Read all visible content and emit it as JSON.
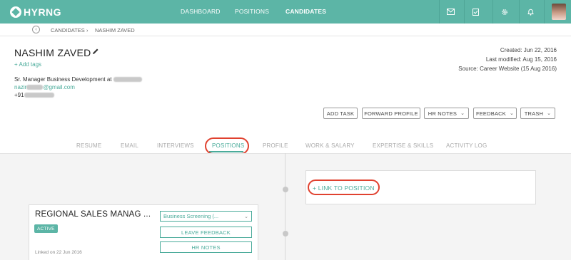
{
  "app": {
    "logo_text": "HYRNG"
  },
  "nav": {
    "items": [
      {
        "label": "DASHBOARD"
      },
      {
        "label": "POSITIONS"
      },
      {
        "label": "CANDIDATES"
      }
    ],
    "active": "CANDIDATES",
    "icons": [
      "mail-icon",
      "checklist-icon",
      "settings-icon",
      "bell-icon"
    ]
  },
  "breadcrumb": {
    "items": [
      "CANDIDATES",
      "›",
      "NASHIM ZAVED"
    ]
  },
  "candidate": {
    "name": "NASHIM ZAVED",
    "add_tags": "+ Add tags",
    "title": "Sr. Manager Business Development at",
    "email_prefix": "nazir",
    "email_suffix": "@gmail.com",
    "phone_prefix": "+91"
  },
  "meta": {
    "created": "Created: Jun 22, 2016",
    "modified": "Last modified: Aug 15, 2016",
    "source": "Source: Career Website (15 Aug 2016)"
  },
  "actions": {
    "add_task": "ADD TASK",
    "forward_profile": "FORWARD PROFILE",
    "hr_notes": "HR NOTES",
    "feedback": "FEEDBACK",
    "trash": "TRASH"
  },
  "tabs": [
    {
      "label": "RESUME"
    },
    {
      "label": "EMAIL"
    },
    {
      "label": "INTERVIEWS"
    },
    {
      "label": "POSITIONS"
    },
    {
      "label": "PROFILE"
    },
    {
      "label": "WORK & SALARY"
    },
    {
      "label": "EXPERTISE & SKILLS"
    },
    {
      "label": "ACTIVITY LOG"
    }
  ],
  "active_tab": "POSITIONS",
  "link_position": {
    "label": "+ LINK TO POSITION"
  },
  "position_card": {
    "title": "REGIONAL SALES MANAG ...",
    "status": "ACTIVE",
    "stage": "Business Screening (...",
    "leave_feedback": "LEAVE FEEDBACK",
    "hr_notes": "HR NOTES",
    "linked_on": "Linked on 22 Jun 2016"
  },
  "colors": {
    "accent": "#5cb5a6",
    "highlight_ring": "#e0412f"
  }
}
